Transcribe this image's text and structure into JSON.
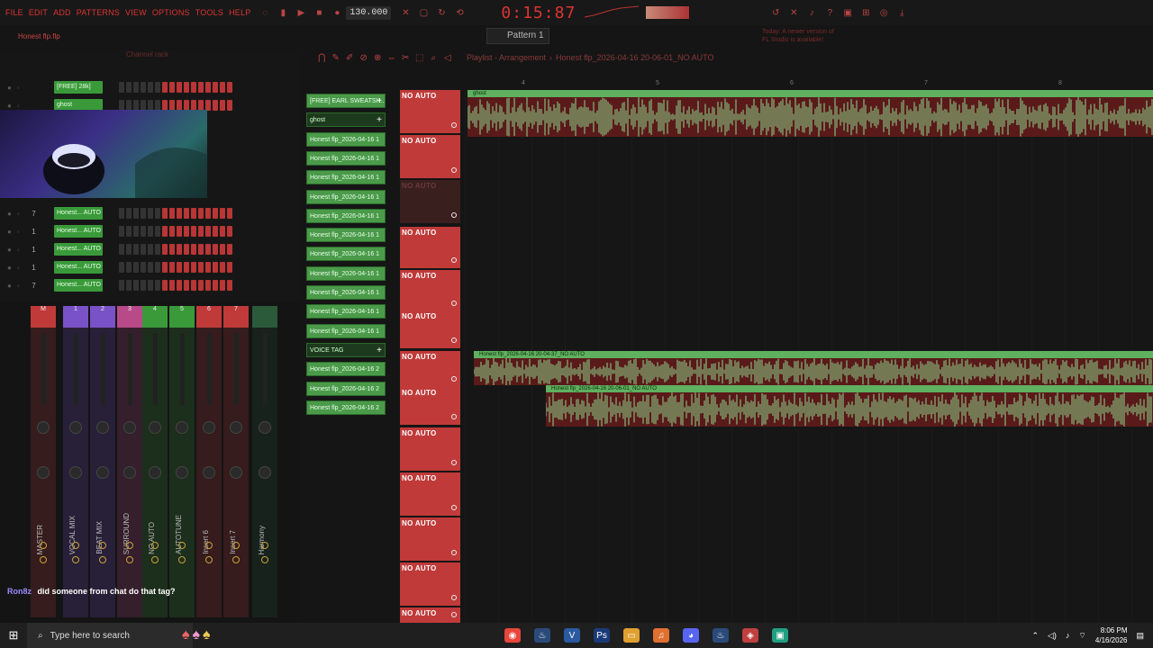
{
  "menu": [
    "FILE",
    "EDIT",
    "ADD",
    "PATTERNS",
    "VIEW",
    "OPTIONS",
    "TOOLS",
    "HELP"
  ],
  "transport": {
    "tempo": "130.000",
    "time": "0:15:87",
    "pattern": "Pattern 1"
  },
  "hint": {
    "line1": "Today: A newer version of",
    "line2": "FL Studio is available!"
  },
  "project": {
    "name": "Honest flp.flp"
  },
  "channel_rack": {
    "title": "Channel rack",
    "channels": [
      {
        "num": "",
        "name": "[FREE] 28k]"
      },
      {
        "num": "",
        "name": "ghost"
      },
      {
        "num": "7",
        "name": "Honest... AUTO"
      },
      {
        "num": "1",
        "name": "Honest... AUTO"
      },
      {
        "num": "1",
        "name": "Honest... AUTO"
      },
      {
        "num": "1",
        "name": "Honest... AUTO"
      },
      {
        "num": "7",
        "name": "Honest... AUTO"
      }
    ]
  },
  "mixer": {
    "strips": [
      {
        "top": "M",
        "name": "MASTER",
        "color": "#c03a3a"
      },
      {
        "top": "1",
        "name": "VOCAL MIX",
        "color": "#7a52c8"
      },
      {
        "top": "2",
        "name": "BEAT MIX",
        "color": "#7a52c8"
      },
      {
        "top": "3",
        "name": "SURROUND",
        "color": "#b84a8a"
      },
      {
        "top": "4",
        "name": "NO AUTO",
        "color": "#3a9a3a"
      },
      {
        "top": "5",
        "name": "AUTOTUNE",
        "color": "#3a9a3a"
      },
      {
        "top": "6",
        "name": "Insert 6",
        "color": "#c03a3a"
      },
      {
        "top": "7",
        "name": "Insert 7",
        "color": "#c03a3a"
      },
      {
        "top": "",
        "name": "Harmony",
        "color": "#2a5a3a"
      }
    ]
  },
  "chat": {
    "user": "Ron8z",
    "message": "did someone from chat do that tag?"
  },
  "picker": {
    "items": [
      {
        "label": "[FREE] EARL SWEATSH...",
        "selected": false,
        "add": true
      },
      {
        "label": "ghost",
        "selected": true,
        "add": true
      },
      {
        "label": "Honest flp_2026-04-16 1",
        "selected": false
      },
      {
        "label": "Honest flp_2026-04-16 1",
        "selected": false
      },
      {
        "label": "Honest flp_2026-04-16 1",
        "selected": false
      },
      {
        "label": "Honest flp_2026-04-16 1",
        "selected": false
      },
      {
        "label": "Honest flp_2026-04-16 1",
        "selected": false
      },
      {
        "label": "Honest flp_2026-04-16 1",
        "selected": false
      },
      {
        "label": "Honest flp_2026-04-16 1",
        "selected": false
      },
      {
        "label": "Honest flp_2026-04-16 1",
        "selected": false
      },
      {
        "label": "Honest flp_2026-04-16 1",
        "selected": false
      },
      {
        "label": "Honest flp_2026-04-16 1",
        "selected": false
      },
      {
        "label": "Honest flp_2026-04-16 1",
        "selected": false
      },
      {
        "label": "VOICE TAG",
        "selected": true,
        "add": true
      },
      {
        "label": "Honest flp_2026-04-16 2",
        "selected": false
      },
      {
        "label": "Honest flp_2026-04-16 2",
        "selected": false
      },
      {
        "label": "Honest flp_2026-04-16 2",
        "selected": false
      }
    ]
  },
  "playlist": {
    "title": "Playlist - Arrangement",
    "current": "Honest flp_2026-04-16 20-06-01_NO AUTO",
    "bars": [
      "4",
      "5",
      "6",
      "7",
      "8"
    ],
    "track_label": "NO AUTO",
    "clips": [
      {
        "name": "ghost"
      },
      {
        "name": "Honest flp_2026-04-16 20-04-37_NO AUTO"
      },
      {
        "name": "Honest flp_2026-04-16 20-06-01_NO AUTO"
      }
    ]
  },
  "taskbar": {
    "search_placeholder": "Type here to search",
    "time": "8:06 PM",
    "date": "4/16/2026",
    "apps": [
      "chrome-icon",
      "steam-icon",
      "v-icon",
      "photoshop-icon",
      "explorer-icon",
      "fl-studio-icon",
      "discord-icon",
      "steam2-icon",
      "app-icon",
      "app2-icon"
    ]
  }
}
